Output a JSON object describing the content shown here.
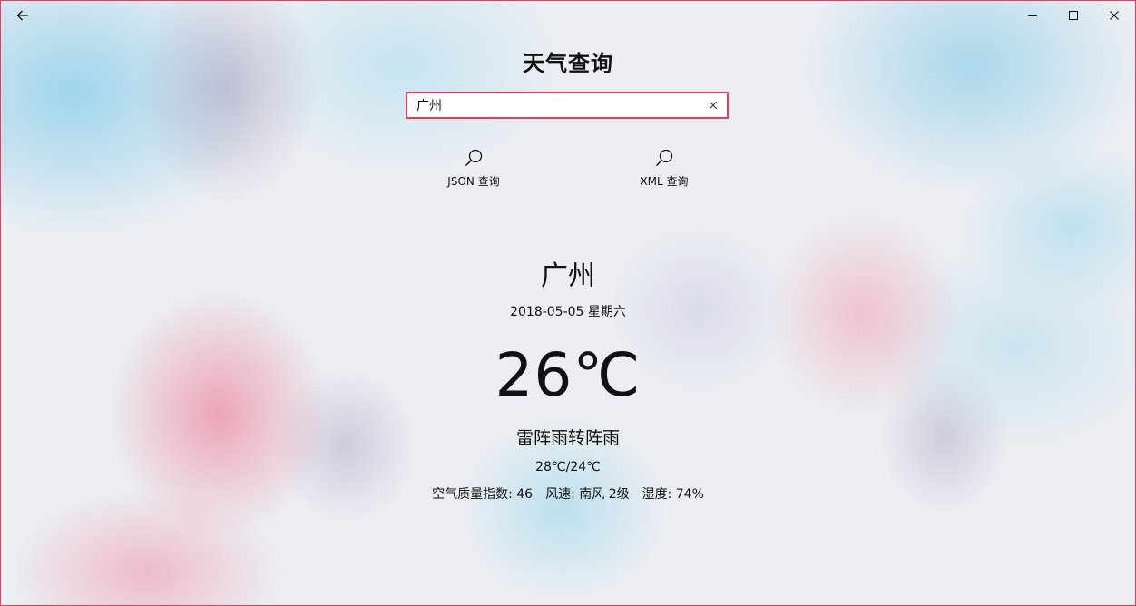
{
  "app": {
    "title": "天气查询"
  },
  "titlebar": {
    "back_icon": "back-arrow-icon",
    "minimize_icon": "minimize-icon",
    "maximize_icon": "maximize-icon",
    "close_icon": "close-icon"
  },
  "search": {
    "value": "广州",
    "placeholder": "",
    "clear_icon": "clear-x-icon"
  },
  "actions": {
    "json_label": "JSON 查询",
    "xml_label": "XML 查询",
    "icon": "search-icon"
  },
  "weather": {
    "city": "广州",
    "date": "2018-05-05 星期六",
    "temperature": "26℃",
    "condition": "雷阵雨转阵雨",
    "range": "28℃/24℃",
    "aqi": "空气质量指数: 46",
    "wind": "风速: 南风 2级",
    "humidity": "湿度: 74%"
  },
  "colors": {
    "accent": "#e0405a"
  }
}
